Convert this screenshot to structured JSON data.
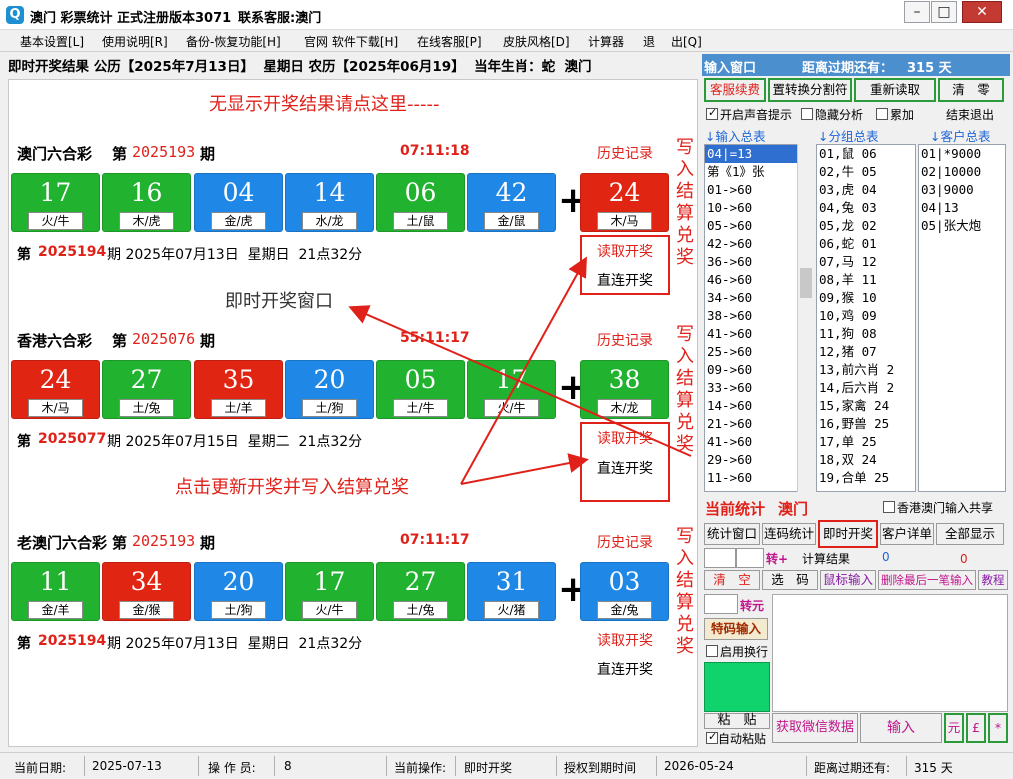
{
  "window": {
    "title": "澳门 彩票统计",
    "version": "正式注册版本3071",
    "contact": "联系客服:澳门",
    "app_icon": "Q"
  },
  "menu": [
    "基本设置[L]",
    "使用说明[R]",
    "备份-恢复功能[H]",
    "官网 软件下载[H]",
    "在线客服[P]",
    "皮肤风格[D]",
    "计算器",
    "退",
    "出[Q]"
  ],
  "infobar": {
    "text": "即时开奖结果 公历【2025年7月13日】  星期日 农历【2025年06月19】  当年生肖：蛇  澳门"
  },
  "hint": "无显示开奖结果请点这里-----",
  "lotteries": [
    {
      "name": "澳门六合彩",
      "period_label": "第",
      "period": "2025193",
      "period_suffix": "期",
      "time": "07:11:18",
      "history": "历史记录",
      "balls": [
        {
          "num": "17",
          "label": "火/牛",
          "color": "green"
        },
        {
          "num": "16",
          "label": "木/虎",
          "color": "green"
        },
        {
          "num": "04",
          "label": "金/虎",
          "color": "blue"
        },
        {
          "num": "14",
          "label": "水/龙",
          "color": "blue"
        },
        {
          "num": "06",
          "label": "土/鼠",
          "color": "green"
        },
        {
          "num": "42",
          "label": "金/鼠",
          "color": "blue"
        }
      ],
      "special": {
        "num": "24",
        "label": "木/马",
        "color": "red"
      },
      "next_prefix": "第",
      "next_period": "2025194",
      "next_text": "期 2025年07月13日  星期日  21点32分",
      "read": "读取开奖",
      "direct": "直连开奖",
      "side": "写入结算兑奖"
    },
    {
      "name": "香港六合彩",
      "period_label": "第",
      "period": "2025076",
      "period_suffix": "期",
      "time": "55:11:17",
      "history": "历史记录",
      "balls": [
        {
          "num": "24",
          "label": "木/马",
          "color": "red"
        },
        {
          "num": "27",
          "label": "土/兔",
          "color": "green"
        },
        {
          "num": "35",
          "label": "土/羊",
          "color": "red"
        },
        {
          "num": "20",
          "label": "土/狗",
          "color": "blue"
        },
        {
          "num": "05",
          "label": "土/牛",
          "color": "green"
        },
        {
          "num": "17",
          "label": "火/牛",
          "color": "green"
        }
      ],
      "special": {
        "num": "38",
        "label": "木/龙",
        "color": "green"
      },
      "next_prefix": "第",
      "next_period": "2025077",
      "next_text": "期 2025年07月15日  星期二  21点32分",
      "read": "读取开奖",
      "direct": "直连开奖",
      "side": "写入结算兑奖"
    },
    {
      "name": "老澳门六合彩",
      "period_label": "第",
      "period": "2025193",
      "period_suffix": "期",
      "time": "07:11:17",
      "history": "历史记录",
      "balls": [
        {
          "num": "11",
          "label": "金/羊",
          "color": "green"
        },
        {
          "num": "34",
          "label": "金/猴",
          "color": "red"
        },
        {
          "num": "20",
          "label": "土/狗",
          "color": "blue"
        },
        {
          "num": "17",
          "label": "火/牛",
          "color": "green"
        },
        {
          "num": "27",
          "label": "土/兔",
          "color": "green"
        },
        {
          "num": "31",
          "label": "火/猪",
          "color": "blue"
        }
      ],
      "special": {
        "num": "03",
        "label": "金/兔",
        "color": "blue"
      },
      "next_prefix": "第",
      "next_period": "2025194",
      "next_text": "期 2025年07月13日  星期日  21点32分",
      "read": "读取开奖",
      "direct": "直连开奖",
      "side": "写入结算兑奖"
    }
  ],
  "annotations": {
    "window_label": "即时开奖窗口",
    "click_label": "点击更新开奖并写入结算兑奖"
  },
  "right": {
    "title": "输入窗口",
    "expire_label": "距离过期还有：",
    "expire_days": "315 天",
    "buttons_row1": [
      "客服续费",
      "置转换分割符",
      "重新读取",
      "清　零"
    ],
    "options": [
      {
        "label": "开启声音提示",
        "checked": true
      },
      {
        "label": "隐藏分析",
        "checked": false
      },
      {
        "label": "累加",
        "checked": false
      }
    ],
    "end_exit": "结束退出",
    "col_headers": [
      "↓输入总表",
      "↓分组总表",
      "↓客户总表"
    ],
    "input_list": [
      "04|=13",
      "第《1》张",
      "01->60",
      "10->60",
      "05->60",
      "42->60",
      "36->60",
      "46->60",
      "34->60",
      "38->60",
      "41->60",
      "25->60",
      "09->60",
      "33->60",
      "14->60",
      "21->60",
      "41->60",
      "29->60",
      "11->60"
    ],
    "group_list": [
      "01,鼠 06",
      "02,牛 05",
      "03,虎 04",
      "04,兔 03",
      "05,龙 02",
      "06,蛇 01",
      "07,马 12",
      "08,羊 11",
      "09,猴 10",
      "10,鸡 09",
      "11,狗 08",
      "12,猪 07",
      "13,前六肖 2",
      "14,后六肖 2",
      "15,家禽 24",
      "16,野兽 25",
      "17,单 25",
      "18,双 24",
      "19,合单 25"
    ],
    "client_list": [
      "01|*9000",
      "02|10000",
      "03|9000",
      "04|13",
      "05|张大炮"
    ],
    "current_stat_label": "当前统计",
    "current_stat_value": "澳门",
    "share_label": "香港澳门输入共享",
    "tabs": [
      "统计窗口",
      "连码统计",
      "即时开奖",
      "客户详单",
      "全部显示"
    ],
    "convert_label": "转+",
    "calc_label": "计算结果",
    "calc_val1": "0",
    "calc_val2": "0",
    "row3": [
      "清　空",
      "选　码",
      "鼠标输入",
      "删除最后一笔输入",
      "教程"
    ],
    "zhuanyuan": "转元",
    "tema": "特码输入",
    "auto_wrap": "启用换行",
    "paste": "粘　贴",
    "auto_paste": "自动粘贴",
    "get_wechat": "获取微信数据",
    "input_btn": "输入",
    "yuan": "元",
    "pound": "£",
    "star": "*"
  },
  "status": {
    "date_label": "当前日期:",
    "date": "2025-07-13",
    "op_label": "操 作 员:",
    "op": "8",
    "cur_op_label": "当前操作:",
    "cur_op": "即时开奖",
    "auth_label": "授权到期时间",
    "auth": "2026-05-24",
    "expire_label": "距离过期还有:",
    "expire": "315 天"
  }
}
